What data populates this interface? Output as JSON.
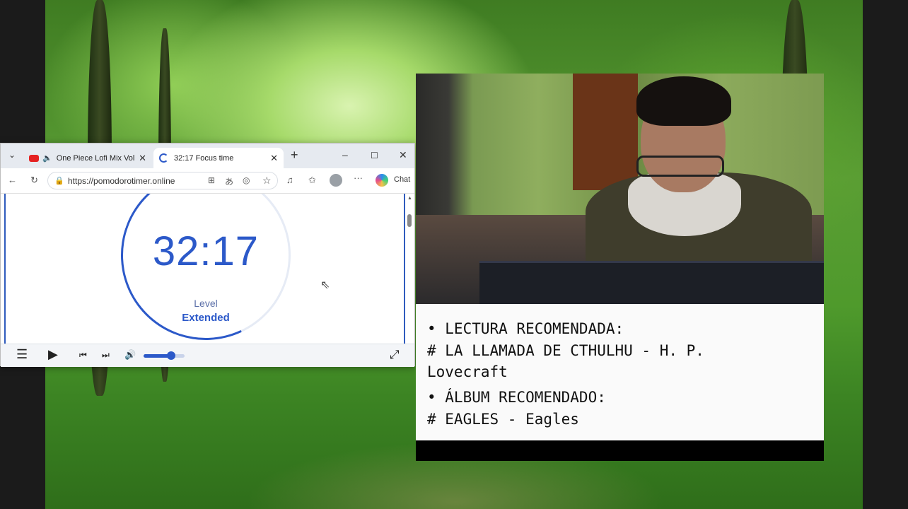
{
  "browser": {
    "tabs": [
      {
        "label": "One Piece Lofi Mix Vol.I",
        "close": "✕"
      },
      {
        "label": "32:17 Focus time",
        "close": "✕"
      }
    ],
    "new_tab": "+",
    "window_controls": {
      "minimize": "–",
      "maximize": "☐",
      "close": "✕"
    },
    "url": "https://pomodorotimer.online",
    "chat_label": "Chat"
  },
  "timer": {
    "time": "32:17",
    "level_label": "Level",
    "level_value": "Extended"
  },
  "player": {
    "volume_fraction": 0.68
  },
  "notes": {
    "line1": "• LECTURA RECOMENDADA:",
    "line2": "# LA LLAMADA DE CTHULHU - H. P.",
    "line3": "Lovecraft",
    "line4": "• ÁLBUM RECOMENDADO:",
    "line5": "# EAGLES - Eagles"
  },
  "colors": {
    "accent": "#2c59c9"
  }
}
